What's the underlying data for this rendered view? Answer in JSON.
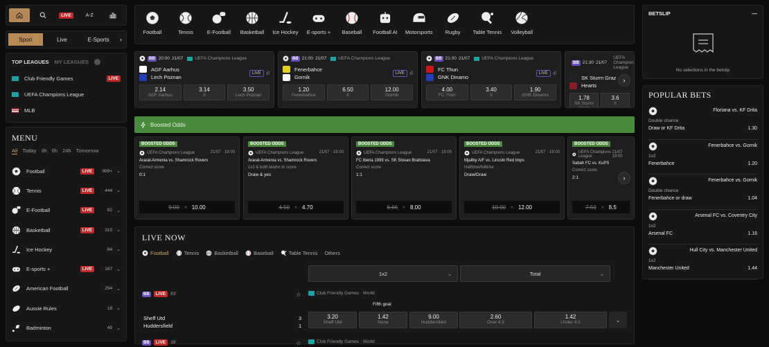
{
  "topnav": {
    "live": "LIVE",
    "az": "A-Z"
  },
  "modes": [
    "Sport",
    "Live",
    "E-Sports"
  ],
  "leagues": {
    "top": "TOP LEAGUES",
    "my": "MY LEAGUES",
    "items": [
      {
        "name": "Club Friendly Games",
        "live": "LIVE",
        "flag": "#1aa3a3"
      },
      {
        "name": "UEFA Champions League",
        "live": "",
        "flag": "#1aa3a3"
      },
      {
        "name": "MLB",
        "live": "",
        "flag": "#b22234"
      }
    ]
  },
  "menu": {
    "title": "MENU",
    "filters": [
      "All",
      "Today",
      "3h",
      "6h",
      "24h",
      "Tomorrow"
    ],
    "sports": [
      {
        "name": "Football",
        "live": "LIVE",
        "count": "999+",
        "icon": "football-icon"
      },
      {
        "name": "Tennis",
        "live": "LIVE",
        "count": "444",
        "icon": "tennis-icon"
      },
      {
        "name": "E-Football",
        "live": "LIVE",
        "count": "82",
        "icon": "e-football-icon"
      },
      {
        "name": "Basketball",
        "live": "LIVE",
        "count": "310",
        "icon": "basketball-icon"
      },
      {
        "name": "Ice Hockey",
        "live": "",
        "count": "84",
        "icon": "ice-hockey-icon"
      },
      {
        "name": "E-sports +",
        "live": "LIVE",
        "count": "187",
        "icon": "esports-icon"
      },
      {
        "name": "American Football",
        "live": "",
        "count": "294",
        "icon": "american-football-icon"
      },
      {
        "name": "Aussie Rules",
        "live": "",
        "count": "18",
        "icon": "aussie-rules-icon"
      },
      {
        "name": "Badminton",
        "live": "",
        "count": "49",
        "icon": "badminton-icon"
      }
    ]
  },
  "sportsbar": [
    "Football",
    "Tennis",
    "E-Football",
    "Basketball",
    "Ice Hockey",
    "E-sports +",
    "Baseball",
    "Football AI",
    "Motorsports",
    "Rugby",
    "Table Tennis",
    "Volleyball"
  ],
  "matches": [
    {
      "time": "20:00",
      "date": "21/07",
      "comp": "UEFA Champions League",
      "t1": "AGF Aarhus",
      "t2": "Lech Poznan",
      "live": "LIVE",
      "odds": [
        {
          "v": "2.14",
          "l": "AGF Aarhus"
        },
        {
          "v": "3.14",
          "l": "X"
        },
        {
          "v": "3.50",
          "l": "Lech Poznan"
        }
      ],
      "c1": "#ffffff",
      "c2": "#1e3fb5"
    },
    {
      "time": "21:00",
      "date": "21/07",
      "comp": "UEFA Champions League",
      "t1": "Fenerbahce",
      "t2": "Gornik",
      "live": "LIVE",
      "odds": [
        {
          "v": "1.20",
          "l": "Fenerbahce"
        },
        {
          "v": "6.50",
          "l": "X"
        },
        {
          "v": "12.00",
          "l": "Gornik"
        }
      ],
      "c1": "#e8d020",
      "c2": "#ffffff"
    },
    {
      "time": "21:00",
      "date": "21/07",
      "comp": "UEFA Champions League",
      "t1": "FC Thun",
      "t2": "GNK Dinamo",
      "live": "LIVE",
      "odds": [
        {
          "v": "4.00",
          "l": "FC Thun"
        },
        {
          "v": "3.40",
          "l": "X"
        },
        {
          "v": "1.90",
          "l": "GNK Dinamo"
        }
      ],
      "c1": "#d01818",
      "c2": "#1e3fb5"
    },
    {
      "time": "21:30",
      "date": "21/07",
      "comp": "UEFA Champions League",
      "t1": "SK Sturm Graz",
      "t2": "Hearts",
      "live": "",
      "odds": [
        {
          "v": "1.78",
          "l": "SK Sturm Graz"
        },
        {
          "v": "3.6",
          "l": "X"
        }
      ],
      "c1": "#222222",
      "c2": "#8a1c2a"
    }
  ],
  "boosted": {
    "label": "Boosted Odds",
    "tag": "BOOSTED ODDS",
    "items": [
      {
        "comp": "UEFA Champions League",
        "dt": "21/07 · 19:00",
        "match": "Ararat-Armenia vs. Shamrock Rovers",
        "market": "Correct score",
        "pick": "0:1",
        "old": "9.00",
        "new": "10.00"
      },
      {
        "comp": "UEFA Champions League",
        "dt": "21/07 · 19:00",
        "match": "Ararat-Armenia vs. Shamrock Rovers",
        "market": "1x2 & both teams to score",
        "pick": "Draw & yes",
        "old": "4.50",
        "new": "4.70"
      },
      {
        "comp": "UEFA Champions League",
        "dt": "21/07 · 19:00",
        "match": "FC Iberia 1999 vs. SK Slovan Bratislava",
        "market": "Correct score",
        "pick": "1:1",
        "old": "6.66",
        "new": "8.00"
      },
      {
        "comp": "UEFA Champions League",
        "dt": "21/07 · 19:00",
        "match": "Mjallby AIF vs. Lincoln Red Imps",
        "market": "Halftime/fulltime",
        "pick": "Draw/Draw",
        "old": "10.00",
        "new": "12.00"
      },
      {
        "comp": "UEFA Champions League",
        "dt": "21/07 · 19:00",
        "match": "Sabah FC vs. KuPS",
        "market": "Correct score",
        "pick": "2:1",
        "old": "7.50",
        "new": "8.5"
      }
    ]
  },
  "livenow": {
    "title": "LIVE NOW",
    "tabs": [
      "Football",
      "Tennis",
      "Basketball",
      "Baseball",
      "Table Tennis",
      "Others"
    ],
    "sel1": "1x2",
    "sel2": "Total",
    "match": {
      "bb": "BB",
      "live": "LIVE",
      "minute": "83'",
      "comp": "Club Friendly Games · World",
      "note": "Fifth goal",
      "t1": "Sheff Utd",
      "t2": "Huddersfield",
      "s1": "3",
      "s2": "1",
      "odds": [
        {
          "v": "3.20",
          "l": "Sheff Utd"
        },
        {
          "v": "1.42",
          "l": "None"
        },
        {
          "v": "9.00",
          "l": "Huddersfield"
        },
        {
          "v": "2.60",
          "l": "Over 4.5"
        },
        {
          "v": "1.42",
          "l": "Under 4.5"
        }
      ]
    },
    "match2": {
      "minute": "39'",
      "comp": "Club Friendly Games · World"
    }
  },
  "betslip": {
    "title": "BETSLIP",
    "empty": "No selections in the betslip"
  },
  "popular": {
    "title": "POPULAR BETS",
    "items": [
      {
        "match": "Floriana vs. KF Drita",
        "market": "Double chance",
        "sel": "Draw or KF Drita",
        "odd": "1.30"
      },
      {
        "match": "Fenerbahce vs. Gornik",
        "market": "1x2",
        "sel": "Fenerbahce",
        "odd": "1.20"
      },
      {
        "match": "Fenerbahce vs. Gornik",
        "market": "Double chance",
        "sel": "Fenerbahce or draw",
        "odd": "1.04"
      },
      {
        "match": "Arsenal FC vs. Coventry City",
        "market": "1x2",
        "sel": "Arsenal FC",
        "odd": "1.16"
      },
      {
        "match": "Hull City vs. Manchester United",
        "market": "1x2",
        "sel": "Manchester United",
        "odd": "1.44"
      }
    ]
  }
}
